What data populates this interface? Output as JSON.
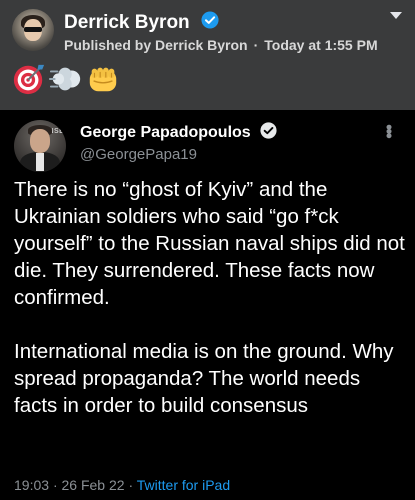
{
  "facebook_post": {
    "author": "Derrick Byron",
    "published_by": "Published by Derrick Byron",
    "separator": "·",
    "time": "Today at 1:55 PM",
    "reaction_emojis": [
      "direct-hit-target",
      "dashing-away-puff",
      "oncoming-fist"
    ]
  },
  "tweet": {
    "display_name": "George Papadopoulos",
    "handle": "@GeorgePapa19",
    "paragraph_1": "There is no “ghost of Kyiv” and the Ukrainian soldiers who said “go f*ck yourself” to the Russian naval ships did not die. They surrendered. These facts now confirmed.",
    "paragraph_2": "International media is on the ground. Why spread propaganda? The world needs facts in order to build consensus",
    "time": "19:03",
    "separator": "·",
    "date": "26 Feb 22",
    "source": "Twitter for iPad",
    "avatar_logo_text": "INSE"
  },
  "colors": {
    "fb_background": "#3a3b3c",
    "tw_background": "#000000",
    "verified_blue": "#1d9bf0",
    "muted_text": "#8b9095"
  }
}
